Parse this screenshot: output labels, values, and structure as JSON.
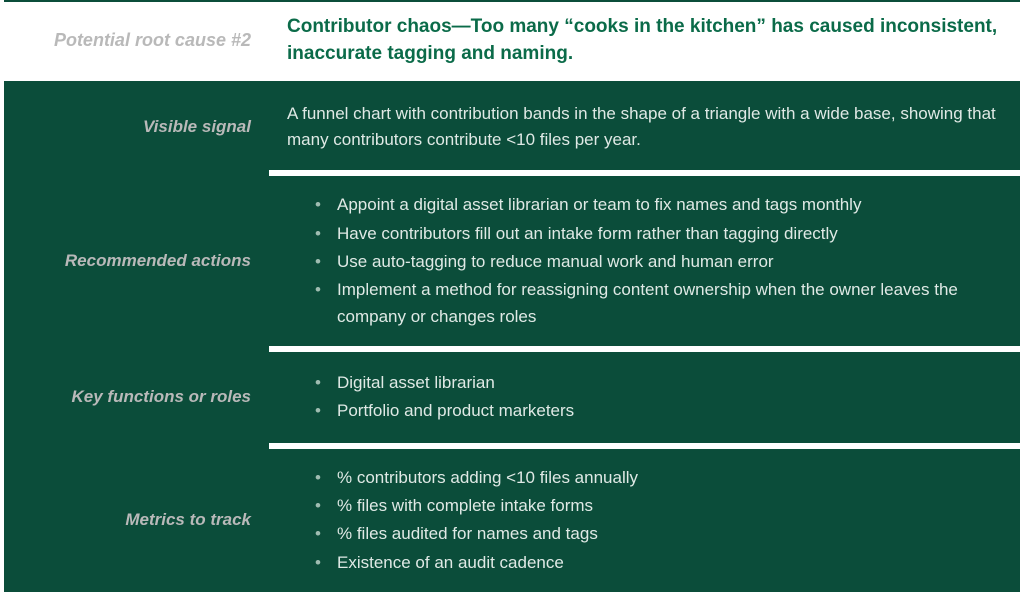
{
  "header": {
    "label": "Potential root cause #2",
    "title": "Contributor chaos—Too many “cooks in the kitchen” has caused inconsistent, inaccurate tagging and naming."
  },
  "rows": [
    {
      "label": "Visible signal",
      "type": "text",
      "text": "A funnel chart with contribution bands in the shape of a triangle with a wide base, showing that many contributors contribute <10 files per year."
    },
    {
      "label": "Recommended actions",
      "type": "list",
      "items": [
        "Appoint a digital asset librarian or team to fix names and tags monthly",
        "Have contributors fill out an intake form rather than tagging directly",
        "Use auto-tagging to reduce manual work and human error",
        "Implement a method for reassigning content ownership when the owner leaves the company or changes roles"
      ]
    },
    {
      "label": "Key functions or roles",
      "type": "list",
      "items": [
        "Digital asset librarian",
        "Portfolio and product marketers"
      ]
    },
    {
      "label": "Metrics to track",
      "type": "list",
      "items": [
        "% contributors adding <10 files annually",
        "% files with complete intake forms",
        "% files audited for names and tags",
        "Existence of an audit cadence"
      ]
    }
  ]
}
